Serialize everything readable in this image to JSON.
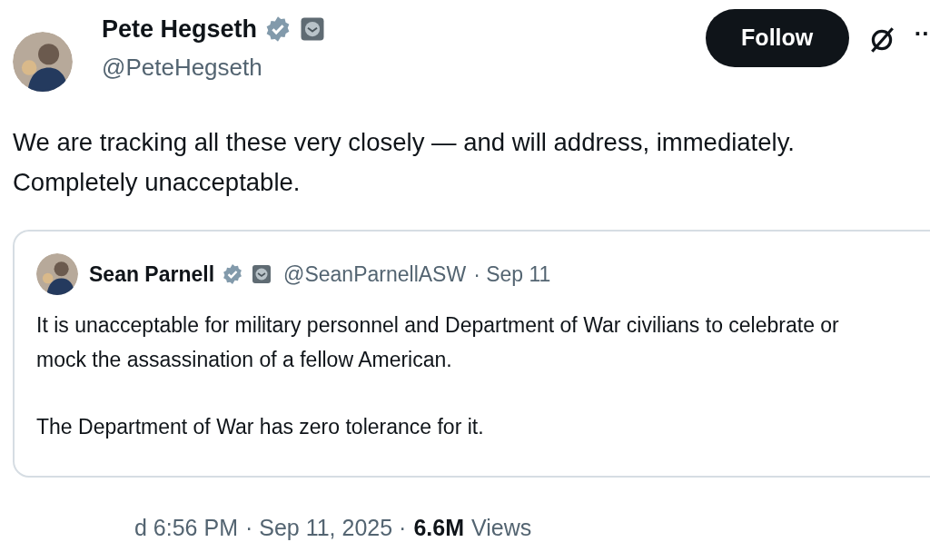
{
  "author": {
    "name": "Pete Hegseth",
    "handle": "@PeteHegseth"
  },
  "follow_button": {
    "label": "Follow"
  },
  "more_button": {
    "label": "··"
  },
  "post_text": "We are tracking all these very closely — and will address, immediately. Completely unacceptable.",
  "quoted_post": {
    "name": "Sean Parnell",
    "handle": "@SeanParnellASW",
    "date": "· Sep 11",
    "paragraphs": [
      "It is unacceptable for military personnel and Department of War civilians to celebrate or mock the assassination of a fellow American.",
      "The Department of War has zero tolerance for it."
    ]
  },
  "footer": {
    "time": "d 6:56 PM",
    "date": "· Sep 11, 2025 ·",
    "views_count": "6.6M",
    "views_label": "Views"
  }
}
